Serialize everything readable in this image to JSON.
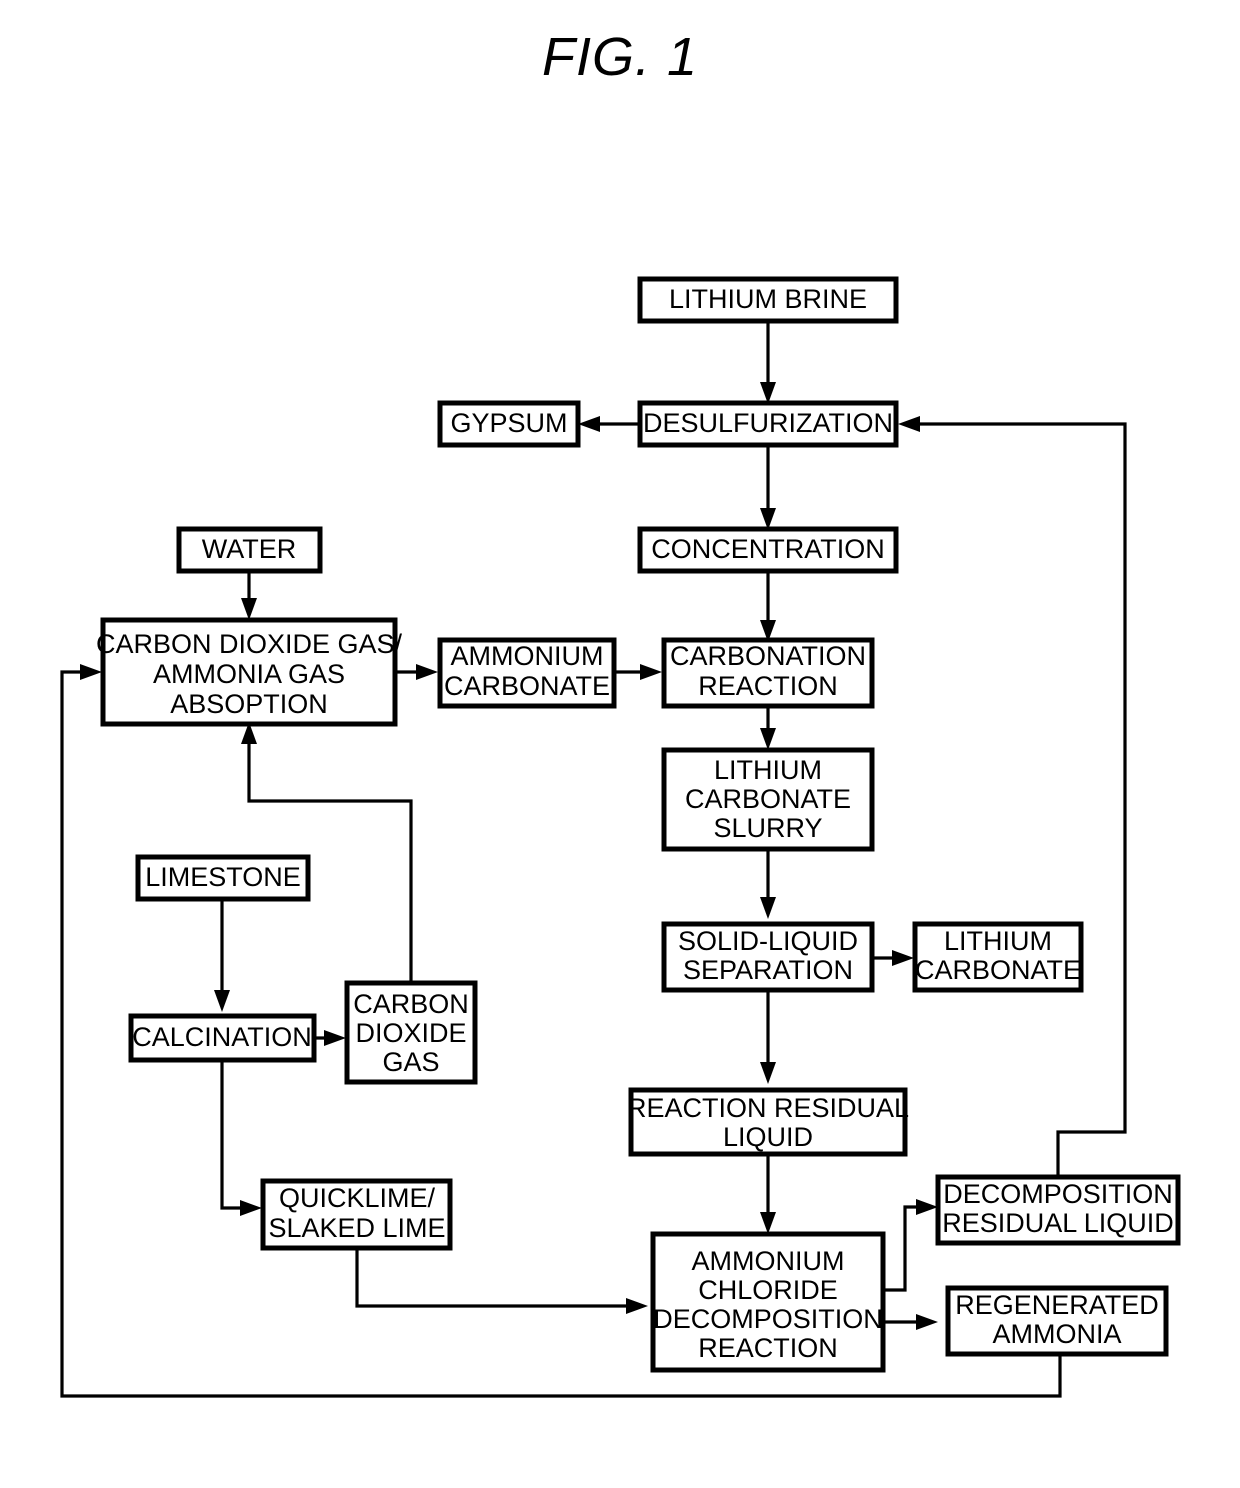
{
  "figure": {
    "title": "FIG. 1",
    "type": "process-flow-diagram",
    "subject": "Lithium carbonate production from lithium brine"
  },
  "nodes": [
    {
      "id": "lithium-brine",
      "label": "LITHIUM BRINE",
      "lines": [
        "LITHIUM BRINE"
      ]
    },
    {
      "id": "desulfurization",
      "label": "DESULFURIZATION",
      "lines": [
        "DESULFURIZATION"
      ]
    },
    {
      "id": "gypsum",
      "label": "GYPSUM",
      "lines": [
        "GYPSUM"
      ]
    },
    {
      "id": "concentration",
      "label": "CONCENTRATION",
      "lines": [
        "CONCENTRATION"
      ]
    },
    {
      "id": "water",
      "label": "WATER",
      "lines": [
        "WATER"
      ]
    },
    {
      "id": "co2-ammonia-absorption",
      "label": "CARBON DIOXIDE GAS/ AMMONIA GAS ABSOPTION",
      "lines": [
        "CARBON DIOXIDE GAS/",
        "AMMONIA GAS",
        "ABSOPTION"
      ]
    },
    {
      "id": "ammonium-carbonate",
      "label": "AMMONIUM CARBONATE",
      "lines": [
        "AMMONIUM",
        "CARBONATE"
      ]
    },
    {
      "id": "carbonation-reaction",
      "label": "CARBONATION REACTION",
      "lines": [
        "CARBONATION",
        "REACTION"
      ]
    },
    {
      "id": "lithium-carbonate-slurry",
      "label": "LITHIUM CARBONATE SLURRY",
      "lines": [
        "LITHIUM",
        "CARBONATE",
        "SLURRY"
      ]
    },
    {
      "id": "solid-liquid-separation",
      "label": "SOLID-LIQUID SEPARATION",
      "lines": [
        "SOLID-LIQUID",
        "SEPARATION"
      ]
    },
    {
      "id": "lithium-carbonate",
      "label": "LITHIUM CARBONATE",
      "lines": [
        "LITHIUM",
        "CARBONATE"
      ]
    },
    {
      "id": "limestone",
      "label": "LIMESTONE",
      "lines": [
        "LIMESTONE"
      ]
    },
    {
      "id": "calcination",
      "label": "CALCINATION",
      "lines": [
        "CALCINATION"
      ]
    },
    {
      "id": "carbon-dioxide-gas",
      "label": "CARBON DIOXIDE GAS",
      "lines": [
        "CARBON",
        "DIOXIDE",
        "GAS"
      ]
    },
    {
      "id": "quicklime-slaked-lime",
      "label": "QUICKLIME/ SLAKED LIME",
      "lines": [
        "QUICKLIME/",
        "SLAKED LIME"
      ]
    },
    {
      "id": "reaction-residual-liquid",
      "label": "REACTION RESIDUAL LIQUID",
      "lines": [
        "REACTION RESIDUAL",
        "LIQUID"
      ]
    },
    {
      "id": "ammonium-chloride-decomposition-reaction",
      "label": "AMMONIUM CHLORIDE DECOMPOSITION REACTION",
      "lines": [
        "AMMONIUM",
        "CHLORIDE",
        "DECOMPOSITION",
        "REACTION"
      ]
    },
    {
      "id": "decomposition-residual-liquid",
      "label": "DECOMPOSITION RESIDUAL LIQUID",
      "lines": [
        "DECOMPOSITION",
        "RESIDUAL LIQUID"
      ]
    },
    {
      "id": "regenerated-ammonia",
      "label": "REGENERATED AMMONIA",
      "lines": [
        "REGENERATED",
        "AMMONIA"
      ]
    }
  ],
  "edges": [
    {
      "id": "e-brine-desulf",
      "from": "lithium-brine",
      "to": "desulfurization"
    },
    {
      "id": "e-desulf-gypsum",
      "from": "desulfurization",
      "to": "gypsum"
    },
    {
      "id": "e-desulf-conc",
      "from": "desulfurization",
      "to": "concentration"
    },
    {
      "id": "e-conc-carbonation",
      "from": "concentration",
      "to": "carbonation-reaction"
    },
    {
      "id": "e-water-absorption",
      "from": "water",
      "to": "co2-ammonia-absorption"
    },
    {
      "id": "e-absorption-ammcarb",
      "from": "co2-ammonia-absorption",
      "to": "ammonium-carbonate"
    },
    {
      "id": "e-ammcarb-carbonation",
      "from": "ammonium-carbonate",
      "to": "carbonation-reaction"
    },
    {
      "id": "e-carbonation-slurry",
      "from": "carbonation-reaction",
      "to": "lithium-carbonate-slurry"
    },
    {
      "id": "e-slurry-separation",
      "from": "lithium-carbonate-slurry",
      "to": "solid-liquid-separation"
    },
    {
      "id": "e-separation-licarb",
      "from": "solid-liquid-separation",
      "to": "lithium-carbonate"
    },
    {
      "id": "e-separation-residual",
      "from": "solid-liquid-separation",
      "to": "reaction-residual-liquid"
    },
    {
      "id": "e-limestone-calcination",
      "from": "limestone",
      "to": "calcination"
    },
    {
      "id": "e-calcination-co2",
      "from": "calcination",
      "to": "carbon-dioxide-gas"
    },
    {
      "id": "e-calcination-quicklime",
      "from": "calcination",
      "to": "quicklime-slaked-lime"
    },
    {
      "id": "e-co2-absorption",
      "from": "carbon-dioxide-gas",
      "to": "co2-ammonia-absorption"
    },
    {
      "id": "e-quicklime-decomp",
      "from": "quicklime-slaked-lime",
      "to": "ammonium-chloride-decomposition-reaction"
    },
    {
      "id": "e-residual-decomp",
      "from": "reaction-residual-liquid",
      "to": "ammonium-chloride-decomposition-reaction"
    },
    {
      "id": "e-decomp-decompresidual",
      "from": "ammonium-chloride-decomposition-reaction",
      "to": "decomposition-residual-liquid"
    },
    {
      "id": "e-decomp-regenammonia",
      "from": "ammonium-chloride-decomposition-reaction",
      "to": "regenerated-ammonia"
    },
    {
      "id": "e-decompresidual-desulf",
      "from": "decomposition-residual-liquid",
      "to": "desulfurization"
    },
    {
      "id": "e-regenammonia-absorption",
      "from": "regenerated-ammonia",
      "to": "co2-ammonia-absorption"
    }
  ],
  "style": {
    "box_stroke": "#000000",
    "box_fill": "#ffffff",
    "line_stroke": "#000000",
    "text_color": "#000000",
    "background": "#ffffff"
  }
}
